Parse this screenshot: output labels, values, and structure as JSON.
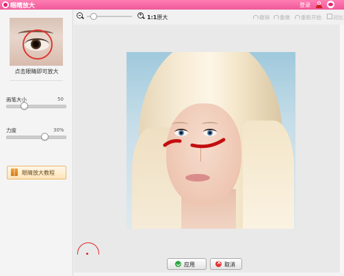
{
  "titlebar": {
    "title": "眼睛放大",
    "login": "登录"
  },
  "left_panel": {
    "thumbnail_hint": "点击眼睛即可放大",
    "brush_size": {
      "label": "画笔大小",
      "value": "50",
      "level": 0.3
    },
    "strength": {
      "label": "力度",
      "value": "30%",
      "level": 0.65
    },
    "tutorial_button": "眼睛放大教程"
  },
  "toolbar": {
    "zoom_level": 0.15,
    "actual_size_bold": "1:1",
    "actual_size_text": "原大",
    "undo": "撤销",
    "redo": "重做",
    "restart": "重新开始",
    "compare": "对比"
  },
  "actions": {
    "apply": "应用",
    "cancel": "取消"
  },
  "colors": {
    "titlebar": "#f0589a",
    "brush_ring": "#e02020",
    "stroke": "#c30f0f",
    "apply_icon": "#2aa640",
    "cancel_icon": "#e2312f"
  }
}
